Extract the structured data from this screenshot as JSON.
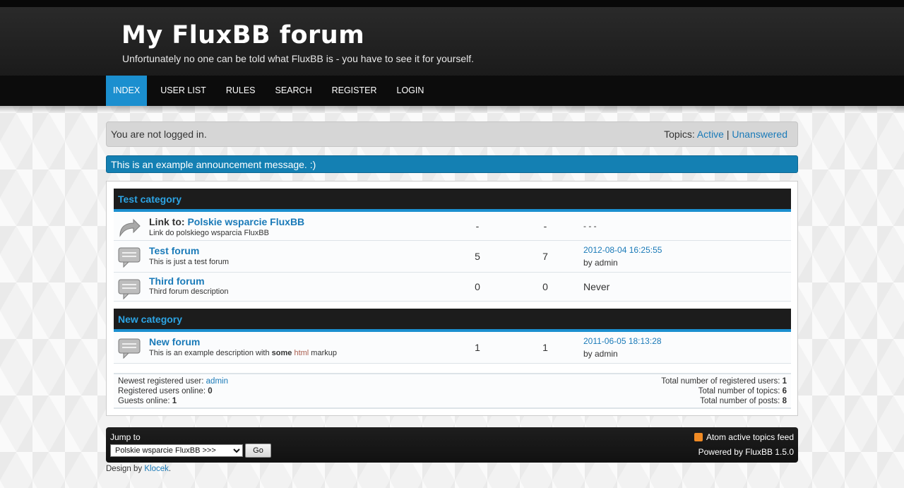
{
  "header": {
    "title": "My FluxBB forum",
    "description": "Unfortunately no one can be told what FluxBB is - you have to see it for yourself."
  },
  "nav": {
    "items": [
      {
        "label": "INDEX",
        "active": true
      },
      {
        "label": "USER LIST"
      },
      {
        "label": "RULES"
      },
      {
        "label": "SEARCH"
      },
      {
        "label": "REGISTER"
      },
      {
        "label": "LOGIN"
      }
    ]
  },
  "status": {
    "login_text": "You are not logged in.",
    "topics_label": "Topics:",
    "active": "Active",
    "separator": "|",
    "unanswered": "Unanswered"
  },
  "announcement": "This is an example announcement message. :)",
  "categories": [
    {
      "name": "Test category",
      "forums": [
        {
          "prefix": "Link to:",
          "name": "Polskie wsparcie FluxBB",
          "desc": "Link do polskiego wsparcia FluxBB",
          "topics": "-",
          "posts": "-",
          "last": "- - -",
          "icon": "redirect-icon"
        },
        {
          "name": "Test forum",
          "desc": "This is just a test forum",
          "topics": "5",
          "posts": "7",
          "last_date": "2012-08-04 16:25:55",
          "last_by": "by admin",
          "icon": "speech-bubble-icon"
        },
        {
          "name": "Third forum",
          "desc": "Third forum description",
          "topics": "0",
          "posts": "0",
          "last": "Never",
          "icon": "speech-bubble-icon"
        }
      ]
    },
    {
      "name": "New category",
      "forums": [
        {
          "name": "New forum",
          "desc_pre": "This is an example description with ",
          "desc_bold": "some",
          "desc_space": " ",
          "desc_html": "html",
          "desc_post": " markup",
          "topics": "1",
          "posts": "1",
          "last_date": "2011-06-05 18:13:28",
          "last_by": "by admin",
          "icon": "speech-bubble-icon"
        }
      ]
    }
  ],
  "stats": {
    "newest_label": "Newest registered user:",
    "newest_user": "admin",
    "online_label": "Registered users online:",
    "online_count": "0",
    "guests_label": "Guests online:",
    "guests_count": "1",
    "total_users_label": "Total number of registered users:",
    "total_users": "1",
    "total_topics_label": "Total number of topics:",
    "total_topics": "6",
    "total_posts_label": "Total number of posts:",
    "total_posts": "8"
  },
  "footer": {
    "jump_label": "Jump to",
    "jump_selected": "Polskie wsparcie FluxBB >>>",
    "go_label": "Go",
    "feed_label": "Atom active topics feed",
    "powered": "Powered by FluxBB 1.5.0"
  },
  "design": {
    "prefix": "Design by",
    "author": "Klocek",
    "suffix": "."
  },
  "colors": {
    "accent": "#1b8fcf",
    "link": "#1a7ab8",
    "announcement": "#1480b3"
  }
}
